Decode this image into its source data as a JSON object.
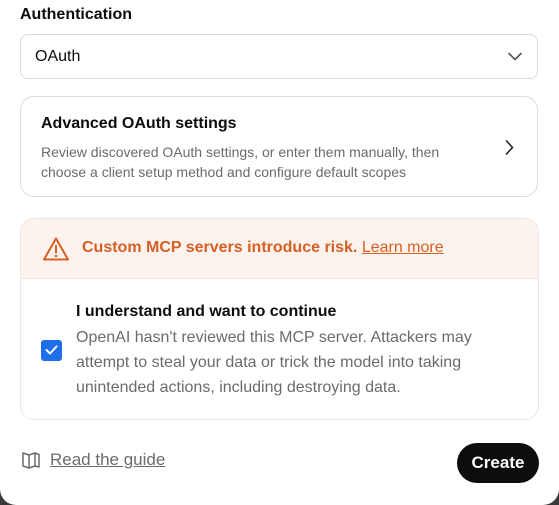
{
  "auth": {
    "label": "Authentication",
    "selected": "OAuth"
  },
  "advanced": {
    "title": "Advanced OAuth settings",
    "description": "Review discovered OAuth settings, or enter them manually, then choose a client setup method and configure default scopes"
  },
  "risk": {
    "warning": "Custom MCP servers introduce risk.",
    "learn_more": "Learn more",
    "accent_color": "#d65f24",
    "consent_title": "I understand and want to continue",
    "consent_description": "OpenAI hasn't reviewed this MCP server. Attackers may attempt to steal your data or trick the model into taking unintended actions, including destroying data.",
    "checked": true
  },
  "footer": {
    "guide_label": "Read the guide",
    "create_label": "Create"
  },
  "icons": [
    "chevron-down-icon",
    "chevron-right-icon",
    "warning-icon",
    "checkmark-icon",
    "book-icon"
  ]
}
